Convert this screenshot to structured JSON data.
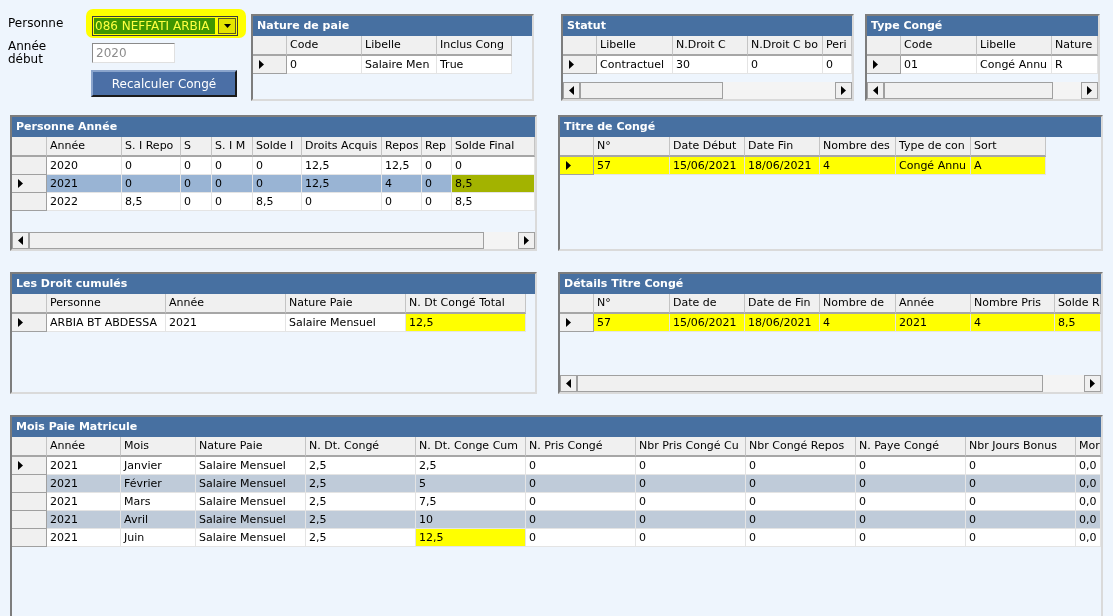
{
  "person_field": {
    "label": "Personne",
    "value": "086 NEFFATI ARBIA",
    "highlighted": true
  },
  "start_year_field": {
    "label": "Année début",
    "value": "2020",
    "disabled": true
  },
  "recalculate_button": {
    "label": "Recalculer Congé"
  },
  "grids": [
    {
      "title": "Nature de paie",
      "horizontal_scrollbar": false,
      "striped": false,
      "columns": [
        "Code",
        "Libelle",
        "Inclus Cong"
      ],
      "rows": [
        {
          "current": true,
          "selected": false,
          "row_header_highlighted": false,
          "cells": [
            {
              "text": "0",
              "highlighted": false
            },
            {
              "text": "Salaire Men",
              "highlighted": false
            },
            {
              "text": "True",
              "highlighted": false
            }
          ]
        }
      ]
    },
    {
      "title": "Statut",
      "horizontal_scrollbar": true,
      "striped": false,
      "columns": [
        "Libelle",
        "N.Droit C",
        "N.Droit C bo",
        "Peri"
      ],
      "rows": [
        {
          "current": true,
          "selected": false,
          "row_header_highlighted": false,
          "cells": [
            {
              "text": "Contractuel",
              "highlighted": false
            },
            {
              "text": "30",
              "highlighted": false
            },
            {
              "text": "0",
              "highlighted": false
            },
            {
              "text": "0",
              "highlighted": false
            }
          ]
        }
      ]
    },
    {
      "title": "Type Congé",
      "horizontal_scrollbar": true,
      "striped": false,
      "columns": [
        "Code",
        "Libelle",
        "Nature"
      ],
      "rows": [
        {
          "current": true,
          "selected": false,
          "row_header_highlighted": false,
          "cells": [
            {
              "text": "01",
              "highlighted": false
            },
            {
              "text": "Congé Annu",
              "highlighted": false
            },
            {
              "text": "R",
              "highlighted": false
            }
          ]
        }
      ]
    },
    {
      "title": "Personne Année",
      "horizontal_scrollbar": true,
      "striped": false,
      "columns": [
        "Année",
        "S. I Repo",
        "S",
        "S. I M",
        "Solde I",
        "Droits Acquis",
        "Repos",
        "Rep",
        "Solde Final"
      ],
      "rows": [
        {
          "current": false,
          "selected": false,
          "row_header_highlighted": false,
          "cells": [
            {
              "text": "2020",
              "highlighted": false
            },
            {
              "text": "0",
              "highlighted": false
            },
            {
              "text": "0",
              "highlighted": false
            },
            {
              "text": "0",
              "highlighted": false
            },
            {
              "text": "0",
              "highlighted": false
            },
            {
              "text": "12,5",
              "highlighted": false
            },
            {
              "text": "12,5",
              "highlighted": false
            },
            {
              "text": "0",
              "highlighted": false
            },
            {
              "text": "0",
              "highlighted": false
            }
          ]
        },
        {
          "current": true,
          "selected": true,
          "row_header_highlighted": false,
          "cells": [
            {
              "text": "2021",
              "highlighted": false
            },
            {
              "text": "0",
              "highlighted": false
            },
            {
              "text": "0",
              "highlighted": false
            },
            {
              "text": "0",
              "highlighted": false
            },
            {
              "text": "0",
              "highlighted": false
            },
            {
              "text": "12,5",
              "highlighted": false
            },
            {
              "text": "4",
              "highlighted": false
            },
            {
              "text": "0",
              "highlighted": false
            },
            {
              "text": "8,5",
              "highlighted": true
            }
          ]
        },
        {
          "current": false,
          "selected": false,
          "row_header_highlighted": false,
          "cells": [
            {
              "text": "2022",
              "highlighted": false
            },
            {
              "text": "8,5",
              "highlighted": false
            },
            {
              "text": "0",
              "highlighted": false
            },
            {
              "text": "0",
              "highlighted": false
            },
            {
              "text": "8,5",
              "highlighted": false
            },
            {
              "text": "0",
              "highlighted": false
            },
            {
              "text": "0",
              "highlighted": false
            },
            {
              "text": "0",
              "highlighted": false
            },
            {
              "text": "8,5",
              "highlighted": false
            }
          ]
        }
      ]
    },
    {
      "title": "Titre de Congé",
      "horizontal_scrollbar": false,
      "striped": false,
      "columns": [
        "N°",
        "Date Début",
        "Date Fin",
        "Nombre des",
        "Type de con",
        "Sort"
      ],
      "rows": [
        {
          "current": true,
          "selected": false,
          "row_header_highlighted": true,
          "cells": [
            {
              "text": "57",
              "highlighted": true
            },
            {
              "text": "15/06/2021",
              "highlighted": true
            },
            {
              "text": "18/06/2021",
              "highlighted": true
            },
            {
              "text": "4",
              "highlighted": true
            },
            {
              "text": "Congé Annu",
              "highlighted": true
            },
            {
              "text": "A",
              "highlighted": true
            }
          ]
        }
      ]
    },
    {
      "title": "Les Droit cumulés",
      "horizontal_scrollbar": false,
      "striped": false,
      "columns": [
        "Personne",
        "Année",
        "Nature Paie",
        "N. Dt Congé Total"
      ],
      "rows": [
        {
          "current": true,
          "selected": false,
          "row_header_highlighted": false,
          "cells": [
            {
              "text": "ARBIA BT ABDESSA",
              "highlighted": false
            },
            {
              "text": "2021",
              "highlighted": false
            },
            {
              "text": "Salaire Mensuel",
              "highlighted": false
            },
            {
              "text": "12,5",
              "highlighted": true
            }
          ]
        }
      ]
    },
    {
      "title": "Détails Titre Congé",
      "horizontal_scrollbar": true,
      "striped": false,
      "columns": [
        "N°",
        "Date de",
        "Date de Fin",
        "Nombre de",
        "Année",
        "Nombre Pris",
        "Solde R"
      ],
      "rows": [
        {
          "current": true,
          "selected": false,
          "row_header_highlighted": false,
          "cells": [
            {
              "text": "57",
              "highlighted": true
            },
            {
              "text": "15/06/2021",
              "highlighted": true
            },
            {
              "text": "18/06/2021",
              "highlighted": true
            },
            {
              "text": "4",
              "highlighted": true
            },
            {
              "text": "2021",
              "highlighted": true
            },
            {
              "text": "4",
              "highlighted": true
            },
            {
              "text": "8,5",
              "highlighted": true
            }
          ]
        }
      ]
    },
    {
      "title": "Mois Paie Matricule",
      "horizontal_scrollbar": false,
      "striped": true,
      "columns": [
        "Année",
        "Mois",
        "Nature Paie",
        "N. Dt. Congé",
        "N. Dt. Conge Cum",
        "N. Pris Congé",
        "Nbr Pris Congé Cu",
        "Nbr Congé Repos",
        "N. Paye Congé",
        "Nbr Jours Bonus",
        "Mor"
      ],
      "rows": [
        {
          "current": true,
          "selected": false,
          "row_header_highlighted": false,
          "cells": [
            {
              "text": "2021",
              "highlighted": false
            },
            {
              "text": "Janvier",
              "highlighted": false
            },
            {
              "text": "Salaire Mensuel",
              "highlighted": false
            },
            {
              "text": "2,5",
              "highlighted": false
            },
            {
              "text": "2,5",
              "highlighted": false
            },
            {
              "text": "0",
              "highlighted": false
            },
            {
              "text": "0",
              "highlighted": false
            },
            {
              "text": "0",
              "highlighted": false
            },
            {
              "text": "0",
              "highlighted": false
            },
            {
              "text": "0",
              "highlighted": false
            },
            {
              "text": "0,0",
              "highlighted": false
            }
          ]
        },
        {
          "current": false,
          "selected": false,
          "row_header_highlighted": false,
          "cells": [
            {
              "text": "2021",
              "highlighted": false
            },
            {
              "text": "Février",
              "highlighted": false
            },
            {
              "text": "Salaire Mensuel",
              "highlighted": false
            },
            {
              "text": "2,5",
              "highlighted": false
            },
            {
              "text": "5",
              "highlighted": false
            },
            {
              "text": "0",
              "highlighted": false
            },
            {
              "text": "0",
              "highlighted": false
            },
            {
              "text": "0",
              "highlighted": false
            },
            {
              "text": "0",
              "highlighted": false
            },
            {
              "text": "0",
              "highlighted": false
            },
            {
              "text": "0,0",
              "highlighted": false
            }
          ]
        },
        {
          "current": false,
          "selected": false,
          "row_header_highlighted": false,
          "cells": [
            {
              "text": "2021",
              "highlighted": false
            },
            {
              "text": "Mars",
              "highlighted": false
            },
            {
              "text": "Salaire Mensuel",
              "highlighted": false
            },
            {
              "text": "2,5",
              "highlighted": false
            },
            {
              "text": "7,5",
              "highlighted": false
            },
            {
              "text": "0",
              "highlighted": false
            },
            {
              "text": "0",
              "highlighted": false
            },
            {
              "text": "0",
              "highlighted": false
            },
            {
              "text": "0",
              "highlighted": false
            },
            {
              "text": "0",
              "highlighted": false
            },
            {
              "text": "0,0",
              "highlighted": false
            }
          ]
        },
        {
          "current": false,
          "selected": false,
          "row_header_highlighted": false,
          "cells": [
            {
              "text": "2021",
              "highlighted": false
            },
            {
              "text": "Avril",
              "highlighted": false
            },
            {
              "text": "Salaire Mensuel",
              "highlighted": false
            },
            {
              "text": "2,5",
              "highlighted": false
            },
            {
              "text": "10",
              "highlighted": false
            },
            {
              "text": "0",
              "highlighted": false
            },
            {
              "text": "0",
              "highlighted": false
            },
            {
              "text": "0",
              "highlighted": false
            },
            {
              "text": "0",
              "highlighted": false
            },
            {
              "text": "0",
              "highlighted": false
            },
            {
              "text": "0,0",
              "highlighted": false
            }
          ]
        },
        {
          "current": false,
          "selected": false,
          "row_header_highlighted": false,
          "cells": [
            {
              "text": "2021",
              "highlighted": false
            },
            {
              "text": "Juin",
              "highlighted": false
            },
            {
              "text": "Salaire Mensuel",
              "highlighted": false
            },
            {
              "text": "2,5",
              "highlighted": false
            },
            {
              "text": "12,5",
              "highlighted": true
            },
            {
              "text": "0",
              "highlighted": false
            },
            {
              "text": "0",
              "highlighted": false
            },
            {
              "text": "0",
              "highlighted": false
            },
            {
              "text": "0",
              "highlighted": false
            },
            {
              "text": "0",
              "highlighted": false
            },
            {
              "text": "0,0",
              "highlighted": false
            }
          ]
        }
      ]
    }
  ]
}
